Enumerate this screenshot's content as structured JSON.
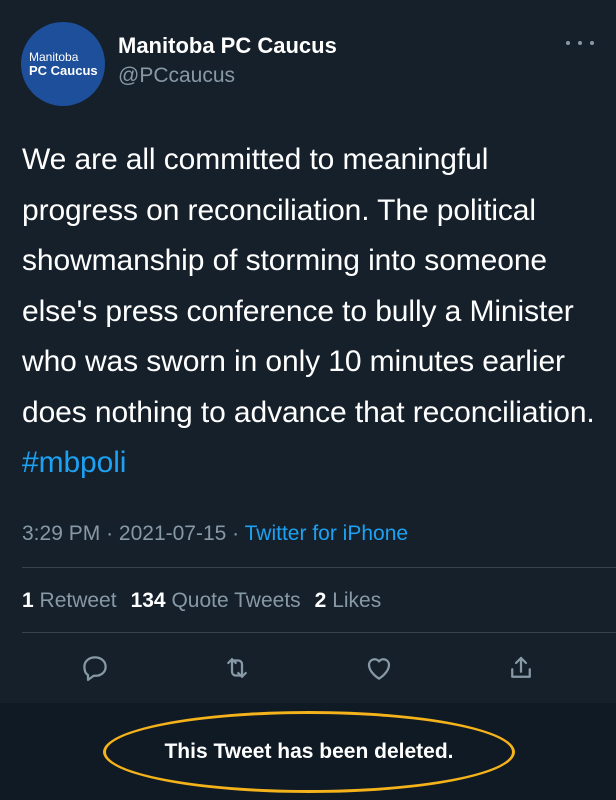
{
  "author": {
    "avatar_line1": "Manitoba",
    "avatar_line2": "PC Caucus",
    "display_name": "Manitoba PC Caucus",
    "handle": "@PCcaucus"
  },
  "tweet": {
    "text": "We are all committed to meaningful progress on reconciliation. The political showmanship of storming into someone else's press conference to bully a Minister who was sworn in only 10 minutes earlier does nothing to advance that reconciliation.",
    "hashtag": "#mbpoli",
    "time": "3:29 PM",
    "date": "2021-07-15",
    "separator": "·",
    "source": "Twitter for iPhone"
  },
  "stats": {
    "retweets_count": "1",
    "retweets_label": "Retweet",
    "quotes_count": "134",
    "quotes_label": "Quote Tweets",
    "likes_count": "2",
    "likes_label": "Likes"
  },
  "actions": {
    "icons": [
      "reply-icon",
      "retweet-icon",
      "like-icon",
      "share-icon"
    ]
  },
  "notice": {
    "deleted_text": "This Tweet has been deleted."
  },
  "colors": {
    "background": "#15202b",
    "accent": "#1da1f2",
    "secondary_text": "#8899a6",
    "highlight_ring": "#f4b21b"
  }
}
